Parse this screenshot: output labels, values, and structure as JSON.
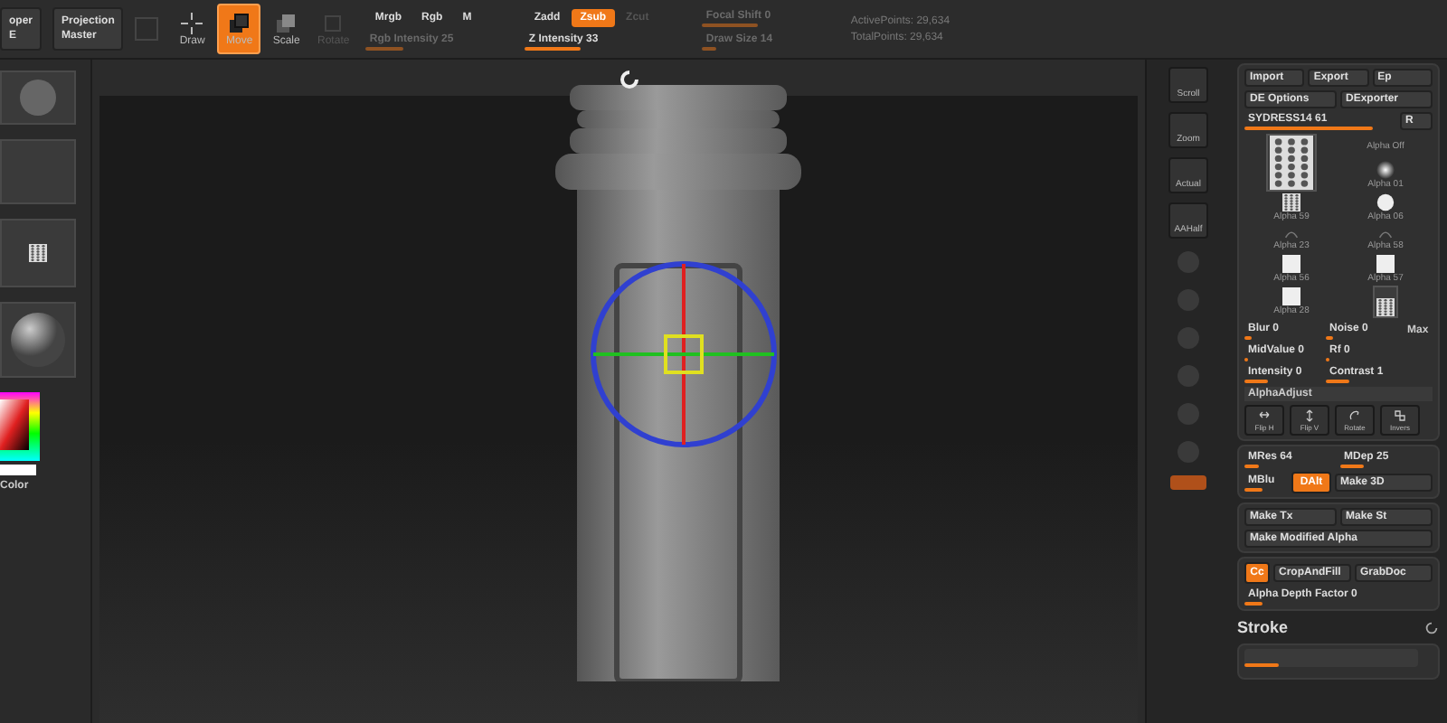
{
  "top_bar": {
    "cut_button": {
      "label": "oper",
      "sublabel": "E"
    },
    "projection_master": {
      "label": "Projection",
      "sublabel": "Master"
    },
    "tools": [
      {
        "label": "Draw",
        "kind": "draw",
        "selected": false,
        "disabled": false
      },
      {
        "label": "Move",
        "kind": "move",
        "selected": true,
        "disabled": false
      },
      {
        "label": "Scale",
        "kind": "scale",
        "selected": false,
        "disabled": false
      },
      {
        "label": "Rotate",
        "kind": "rotate",
        "selected": false,
        "disabled": true
      }
    ],
    "rgb_modes": [
      {
        "label": "Mrgb",
        "selected": false
      },
      {
        "label": "Rgb",
        "selected": false
      },
      {
        "label": "M",
        "selected": false
      }
    ],
    "rgb_intensity": {
      "label": "Rgb Intensity 25",
      "level": 0.25,
      "disabled": true
    },
    "z_modes": [
      {
        "label": "Zadd",
        "selected": false,
        "disabled": false
      },
      {
        "label": "Zsub",
        "selected": true,
        "disabled": false
      },
      {
        "label": "Zcut",
        "selected": false,
        "disabled": true
      }
    ],
    "z_intensity": {
      "label": "Z Intensity 33",
      "level": 0.33,
      "disabled": false
    },
    "focal_shift": {
      "label": "Focal Shift 0",
      "level": 0.5,
      "disabled": true
    },
    "draw_size": {
      "label": "Draw Size 14",
      "level": 0.12,
      "disabled": true
    },
    "stats": [
      "ActivePoints: 29,634",
      "TotalPoints: 29,634"
    ]
  },
  "left_shelf": {
    "color_label": "Color"
  },
  "right_shelf": [
    {
      "label": "Scroll"
    },
    {
      "label": "Zoom"
    },
    {
      "label": "Actual"
    },
    {
      "label": "AAHalf"
    }
  ],
  "alpha_panel": {
    "top_buttons": [
      {
        "label": "Import"
      },
      {
        "label": "Export"
      },
      {
        "label": "Ep"
      }
    ],
    "plugin_buttons": [
      {
        "label": "DE Options"
      },
      {
        "label": "DExporter"
      }
    ],
    "alpha_slider": {
      "label": "SYDRESS14 61",
      "level": 0.85
    },
    "slider_button": "R",
    "alphas": [
      {
        "kind": "pattern",
        "selected": true,
        "large": true
      },
      {
        "label": "Alpha Off",
        "kind": "off",
        "selected": false,
        "large": false
      },
      {
        "label": "Alpha 01",
        "kind": "soft",
        "selected": false,
        "large": false
      },
      {
        "label": "Alpha 59",
        "kind": "pattern",
        "selected": false,
        "large": false
      },
      {
        "label": "Alpha 06",
        "kind": "dot",
        "selected": false,
        "large": false
      },
      {
        "label": "Alpha 23",
        "kind": "faint",
        "selected": false,
        "large": false
      },
      {
        "label": "Alpha 58",
        "kind": "faint",
        "selected": false,
        "large": false
      },
      {
        "label": "Alpha 56",
        "kind": "square",
        "selected": false,
        "large": false
      },
      {
        "label": "Alpha 57",
        "kind": "square",
        "selected": false,
        "large": false
      },
      {
        "label": "Alpha 28",
        "kind": "square",
        "selected": false,
        "large": false
      },
      {
        "kind": "pattern",
        "selected": true,
        "large": false
      }
    ],
    "adjust_rows": [
      [
        {
          "label": "Blur 0",
          "kind": "slider",
          "level": 0.1
        },
        {
          "label": "Noise 0",
          "kind": "slider",
          "level": 0.1
        },
        {
          "label": "Max",
          "kind": "text"
        }
      ],
      [
        {
          "label": "MidValue 0",
          "kind": "slider",
          "level": 0.05
        },
        {
          "label": "Rf 0",
          "kind": "slider",
          "level": 0.05
        }
      ],
      [
        {
          "label": "Intensity 0",
          "kind": "slider",
          "level": 0.3
        },
        {
          "label": "Contrast 1",
          "kind": "slider",
          "level": 0.3
        }
      ]
    ],
    "alpha_adjust": "AlphaAdjust",
    "transforms": [
      {
        "label": "Flip H",
        "kind": "fliph"
      },
      {
        "label": "Flip V",
        "kind": "flipv"
      },
      {
        "label": "Rotate",
        "kind": "rotate"
      },
      {
        "label": "Invers",
        "kind": "invert"
      }
    ],
    "mres_row": [
      {
        "label": "MRes 64",
        "level": 0.15
      },
      {
        "label": "MDep 25",
        "level": 0.25
      }
    ],
    "mode_row": [
      {
        "label": "MBlu",
        "kind": "slider",
        "level": 0.4
      },
      {
        "label": "DAlt",
        "kind": "toggle",
        "selected": true
      },
      {
        "label": "Make 3D",
        "kind": "button",
        "selected": false
      }
    ],
    "make_row": [
      {
        "label": "Make Tx"
      },
      {
        "label": "Make St"
      }
    ],
    "make_modified": "Make Modified Alpha",
    "grab_row": [
      {
        "label": "Cc",
        "kind": "toggle",
        "selected": true
      },
      {
        "label": "CropAndFill",
        "kind": "button",
        "selected": false
      },
      {
        "label": "GrabDoc",
        "kind": "button",
        "selected": false
      }
    ],
    "depth_factor": {
      "label": "Alpha Depth Factor 0",
      "level": 0.1
    }
  },
  "stroke_panel": {
    "title": "Stroke",
    "slider": {
      "level": 0.2
    }
  }
}
